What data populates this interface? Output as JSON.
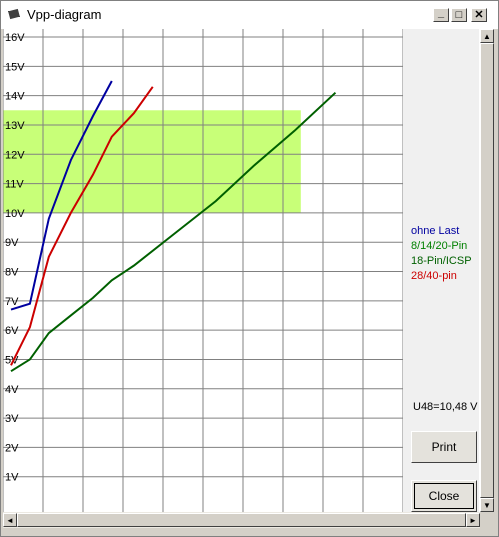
{
  "window": {
    "title": "Vpp-diagram",
    "icon": "chip-icon",
    "minimize_glyph": "_",
    "maximize_glyph": "□",
    "close_glyph": "✕"
  },
  "colors": {
    "grid": "#808080",
    "band": "#c8ff78",
    "ohne_last": "#0000a0",
    "pin_8_14_20": "#008000",
    "pin_18_icsp": "#006000",
    "pin_28_40": "#cc0000"
  },
  "chart_data": {
    "type": "line",
    "title": "",
    "xlabel": "",
    "ylabel": "",
    "y_unit": "V",
    "y_ticks": [
      "1V",
      "2V",
      "3V",
      "4V",
      "5V",
      "6V",
      "7V",
      "8V",
      "9V",
      "10V",
      "11V",
      "12V",
      "13V",
      "14V",
      "15V",
      "16V"
    ],
    "ylim": [
      0,
      16.2
    ],
    "xlim": [
      0,
      13
    ],
    "grid": true,
    "highlight_band": {
      "x": [
        0,
        9.2
      ],
      "y": [
        10.0,
        13.5
      ]
    },
    "series": [
      {
        "name": "ohne Last",
        "color": "#0000a0",
        "x": [
          0,
          0.6,
          1.2,
          1.9,
          2.6,
          3.2
        ],
        "y": [
          6.7,
          6.9,
          9.8,
          11.8,
          13.3,
          14.5
        ]
      },
      {
        "name": "28/40-pin",
        "color": "#cc0000",
        "x": [
          0,
          0.6,
          1.2,
          1.9,
          2.6,
          3.2,
          3.9,
          4.5
        ],
        "y": [
          4.8,
          6.1,
          8.5,
          10.0,
          11.3,
          12.6,
          13.4,
          14.3
        ]
      },
      {
        "name": "18-Pin/ICSP",
        "color": "#006000",
        "x": [
          0,
          0.6,
          1.2,
          1.9,
          2.6,
          3.2,
          3.9,
          5.2,
          6.5,
          7.7,
          9.0,
          10.3
        ],
        "y": [
          4.6,
          5.0,
          5.9,
          6.5,
          7.1,
          7.7,
          8.2,
          9.3,
          10.4,
          11.6,
          12.8,
          14.1
        ]
      }
    ],
    "legend": [
      {
        "label": "ohne Last",
        "color": "#0000a0"
      },
      {
        "label": "8/14/20-Pin",
        "color": "#008000"
      },
      {
        "label": "18-Pin/ICSP",
        "color": "#006000"
      },
      {
        "label": "28/40-pin",
        "color": "#cc0000"
      }
    ],
    "legend_position": "right"
  },
  "readout": "U48=10,48 V",
  "buttons": {
    "print": "Print",
    "close": "Close"
  },
  "scroll": {
    "up": "▲",
    "down": "▼",
    "left": "◄",
    "right": "►"
  }
}
